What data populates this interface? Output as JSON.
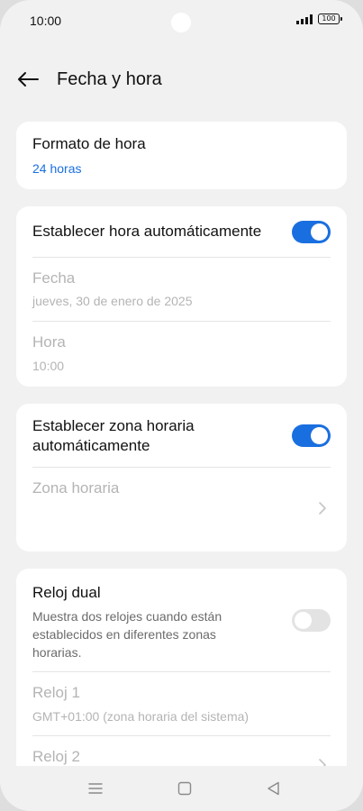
{
  "status": {
    "time": "10:00",
    "battery": "100"
  },
  "header": {
    "title": "Fecha y hora"
  },
  "format": {
    "title": "Formato de hora",
    "value": "24 horas"
  },
  "auto_time": {
    "title": "Establecer hora automáticamente",
    "enabled": true,
    "date_label": "Fecha",
    "date_value": "jueves, 30 de enero de 2025",
    "time_label": "Hora",
    "time_value": "10:00"
  },
  "auto_zone": {
    "title_line1": "Establecer zona horaria",
    "title_line2": "automáticamente",
    "enabled": true,
    "zone_label": "Zona horaria"
  },
  "dual_clock": {
    "title": "Reloj dual",
    "description": "Muestra dos relojes cuando están establecidos en diferentes zonas horarias.",
    "enabled": false,
    "clock1_label": "Reloj 1",
    "clock1_value": "GMT+01:00 (zona horaria del sistema)",
    "clock2_label": "Reloj 2"
  },
  "icons": [
    "back-arrow-icon",
    "chevron-right-icon",
    "menu-icon",
    "home-icon",
    "back-triangle-icon"
  ],
  "colors": {
    "accent": "#1a6fe0",
    "background": "#f1f1f1",
    "card": "#ffffff",
    "disabled_text": "#b4b4b4"
  }
}
